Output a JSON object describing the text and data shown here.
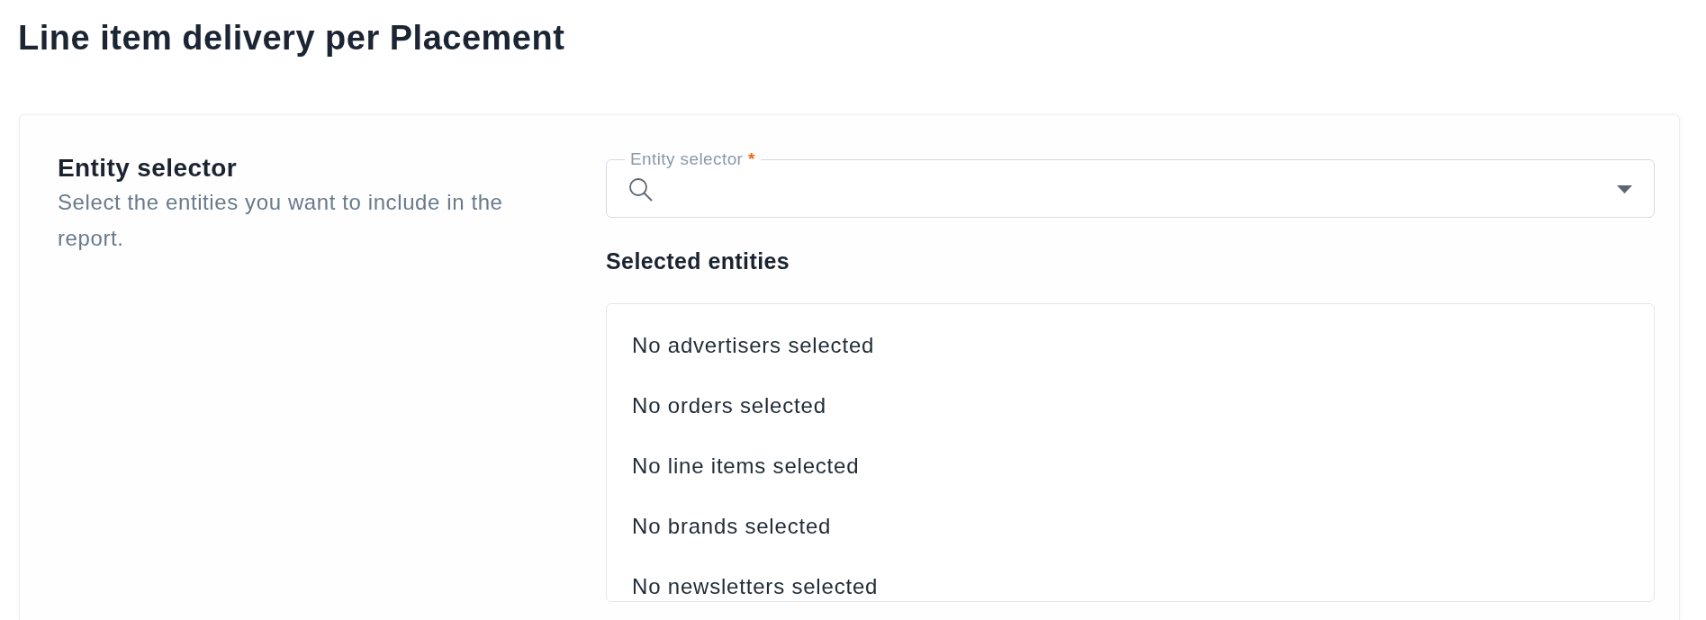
{
  "page_title": "Line item delivery per Placement",
  "section": {
    "title": "Entity selector",
    "description": "Select the entities you want to include in the report.",
    "entity_field": {
      "label": "Entity selector",
      "required_mark": "*"
    },
    "selected_entities": {
      "title": "Selected entities",
      "items": [
        "No advertisers selected",
        "No orders selected",
        "No line items selected",
        "No brands selected",
        "No newsletters selected"
      ]
    }
  }
}
